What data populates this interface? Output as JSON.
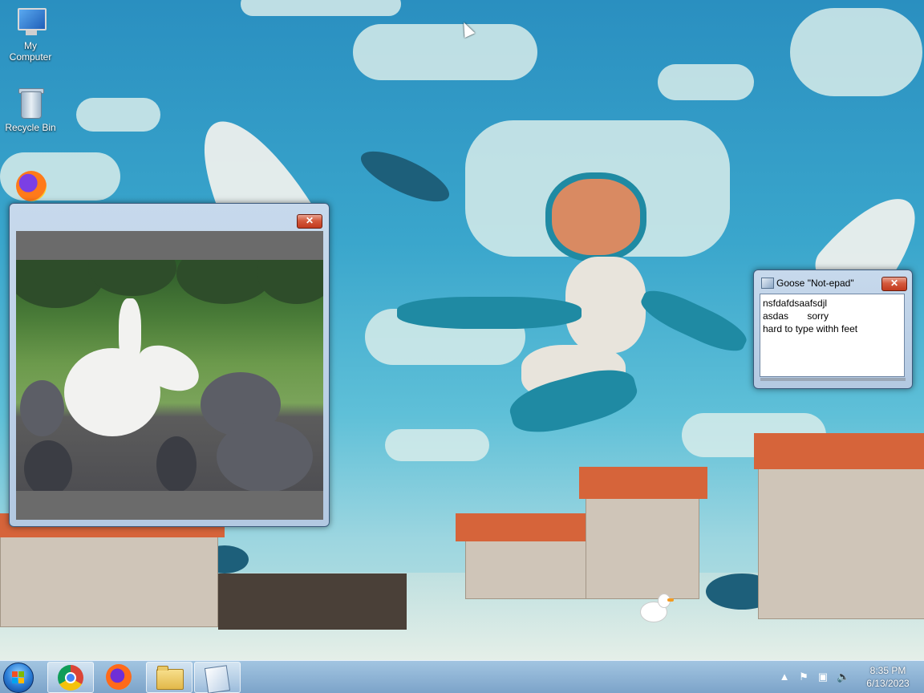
{
  "desktop": {
    "icons": [
      {
        "label": "My Computer",
        "icon": "my-computer-icon"
      },
      {
        "label": "Recycle Bin",
        "icon": "recycle-bin-icon"
      },
      {
        "label": "",
        "icon": "firefox-icon"
      }
    ]
  },
  "video_window": {
    "close_label": "✕",
    "content": "goose-and-pigeons-video"
  },
  "notepad": {
    "title": "Goose \"Not-epad\"",
    "close_label": "✕",
    "text": "nsfdafdsaafsdjl\nasdas       sorry\nhard to type withh feet"
  },
  "taskbar": {
    "start": "start-orb",
    "pinned": [
      "chrome-icon",
      "firefox-icon",
      "file-explorer-icon",
      "notepad-icon"
    ],
    "clock_time": "8:35 PM",
    "clock_date": "6/13/2023",
    "tray_icons": [
      "show-hidden-icons-arrow",
      "action-center-flag-icon",
      "network-icon",
      "volume-muted-icon"
    ]
  },
  "colors": {
    "taskbar": "#8fb3d6",
    "close_button": "#c8432a",
    "sky": "#2a8fc0"
  }
}
